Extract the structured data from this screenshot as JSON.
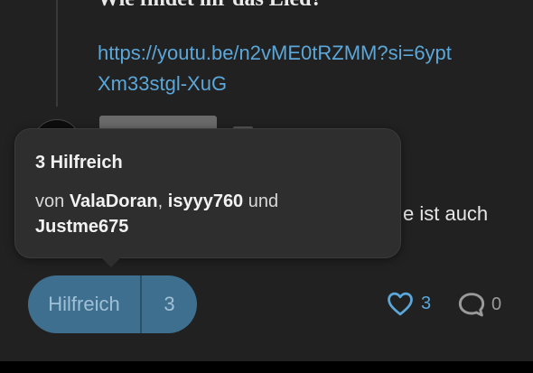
{
  "post": {
    "quote_title": "Wie findet ihr das Lied?",
    "link": "https://youtu.be/n2vME0tRZMM?si=6yptXm33stgl-XuG",
    "body_tail": "e ist auch"
  },
  "tooltip": {
    "title": "3 Hilfreich",
    "prefix": "von ",
    "user1": "ValaDoran",
    "sep": ", ",
    "user2": "isyyy760",
    "and": " und",
    "user3": "Justme675"
  },
  "actions": {
    "helpful_label": "Hilfreich",
    "helpful_count": "3",
    "likes": "3",
    "comments": "0",
    "accent": "#5ba7d9"
  }
}
